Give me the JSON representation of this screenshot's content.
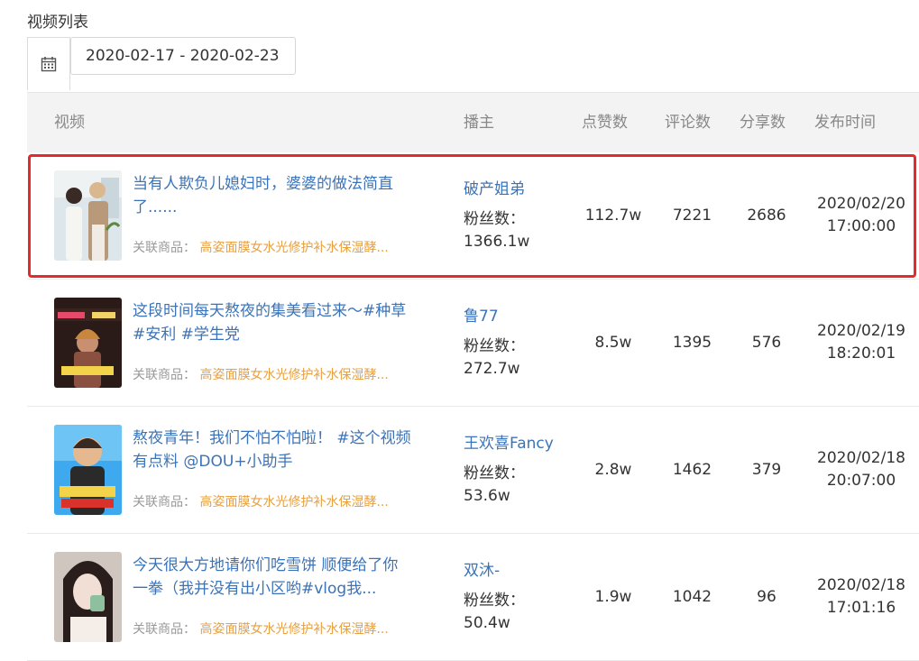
{
  "page": {
    "section_title": "视频列表"
  },
  "date_filter": {
    "value": "2020-02-17 - 2020-02-23",
    "icon": "calendar-icon"
  },
  "columns": {
    "video": "视频",
    "anchor": "播主",
    "likes": "点赞数",
    "comments": "评论数",
    "shares": "分享数",
    "publish_time": "发布时间"
  },
  "goods_label": "关联商品：",
  "fans_label": "粉丝数：",
  "rows": [
    {
      "title": "当有人欺负儿媳妇时，婆婆的做法简直了......",
      "goods": "高姿面膜女水光修护补水保湿酵...",
      "anchor": "破产姐弟",
      "fans": "1366.1w",
      "likes": "112.7w",
      "comments": "7221",
      "shares": "2686",
      "date": "2020/02/20",
      "time": "17:00:00"
    },
    {
      "title": "这段时间每天熬夜的集美看过来～#种草 #安利 #学生党",
      "goods": "高姿面膜女水光修护补水保湿酵...",
      "anchor": "鲁77",
      "fans": "272.7w",
      "likes": "8.5w",
      "comments": "1395",
      "shares": "576",
      "date": "2020/02/19",
      "time": "18:20:01"
    },
    {
      "title": "熬夜青年！我们不怕不怕啦！ #这个视频有点料 @DOU+小助手",
      "goods": "高姿面膜女水光修护补水保湿酵...",
      "anchor": "王欢喜Fancy",
      "fans": "53.6w",
      "likes": "2.8w",
      "comments": "1462",
      "shares": "379",
      "date": "2020/02/18",
      "time": "20:07:00"
    },
    {
      "title": "今天很大方地请你们吃雪饼 顺便给了你一拳（我并没有出小区哟#vlog我...",
      "goods": "高姿面膜女水光修护补水保湿酵...",
      "anchor": "双沐-",
      "fans": "50.4w",
      "likes": "1.9w",
      "comments": "1042",
      "shares": "96",
      "date": "2020/02/18",
      "time": "17:01:16"
    }
  ]
}
